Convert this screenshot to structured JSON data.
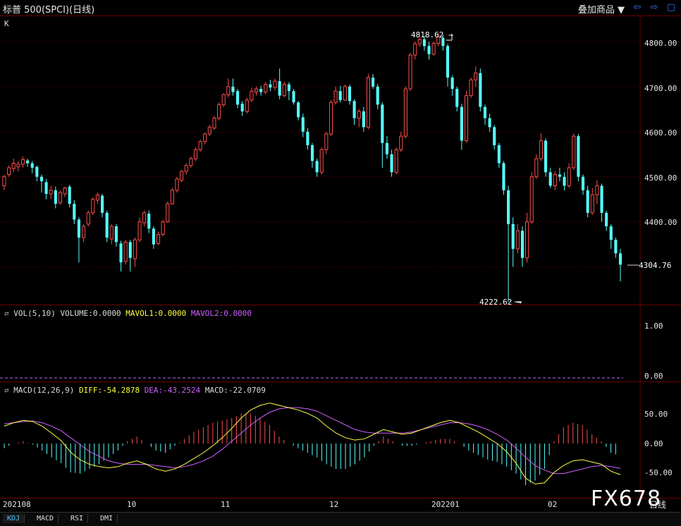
{
  "window": {
    "title": "标普 500(SPCI)(日线)",
    "overlay_label": "叠加商品 ▼",
    "nav_left_icon": "back-arrow-icon",
    "nav_right_icon": "forward-arrow-icon"
  },
  "price_panel": {
    "label": "K",
    "high_marker": "4818.62 →",
    "low_marker": "4222.62 →",
    "last_price": "4304.76"
  },
  "volume_panel": {
    "label": "VOL(5,10)",
    "volume": "VOLUME:0.0000",
    "mavol1": "MAVOL1:0.0000",
    "mavol2": "MAVOL2:0.0000"
  },
  "macd_panel": {
    "label": "MACD(12,26,9)",
    "diff": "DIFF:-54.2878",
    "dea": "DEA:-43.2524",
    "macd": "MACD:-22.0709"
  },
  "axis": {
    "price_ticks": [
      "4800.00",
      "4700.00",
      "4600.00",
      "4500.00",
      "4400.00"
    ],
    "volume_ticks": [
      "1.00",
      "0.00"
    ],
    "macd_ticks": [
      "50.00",
      "0.00",
      "-50.00"
    ],
    "date_labels": [
      "202108",
      "10",
      "11",
      "12",
      "202201",
      "02"
    ],
    "unit": "日线"
  },
  "tabs": [
    "KDJ",
    "MACD",
    "RSI",
    "DMI"
  ],
  "watermark": "FX678",
  "colors": {
    "up": "#ff4d4d",
    "down": "#54ffff",
    "grid": "#6b0000",
    "diff": "#ffff40",
    "dea": "#d060ff"
  },
  "chart_data": {
    "type": "candlestick",
    "title": "标普 500(SPCI)(日线)",
    "ylim": [
      4200,
      4860
    ],
    "high_label": 4818.62,
    "low_label": 4222.62,
    "last": 4304.76,
    "series": [
      {
        "name": "candles",
        "values": [
          [
            4480,
            4500,
            4470,
            4505
          ],
          [
            4505,
            4520,
            4500,
            4525
          ],
          [
            4518,
            4530,
            4510,
            4540
          ],
          [
            4522,
            4528,
            4512,
            4535
          ],
          [
            4528,
            4538,
            4520,
            4545
          ],
          [
            4536,
            4530,
            4522,
            4540
          ],
          [
            4530,
            4520,
            4508,
            4535
          ],
          [
            4522,
            4500,
            4490,
            4525
          ],
          [
            4500,
            4490,
            4465,
            4505
          ],
          [
            4488,
            4462,
            4450,
            4495
          ],
          [
            4462,
            4470,
            4450,
            4480
          ],
          [
            4470,
            4440,
            4430,
            4478
          ],
          [
            4442,
            4465,
            4438,
            4470
          ],
          [
            4462,
            4475,
            4455,
            4478
          ],
          [
            4478,
            4440,
            4432,
            4482
          ],
          [
            4440,
            4405,
            4395,
            4448
          ],
          [
            4405,
            4365,
            4310,
            4410
          ],
          [
            4365,
            4390,
            4355,
            4395
          ],
          [
            4395,
            4420,
            4390,
            4425
          ],
          [
            4420,
            4450,
            4415,
            4455
          ],
          [
            4448,
            4460,
            4440,
            4465
          ],
          [
            4458,
            4420,
            4410,
            4462
          ],
          [
            4420,
            4365,
            4355,
            4425
          ],
          [
            4362,
            4390,
            4350,
            4395
          ],
          [
            4390,
            4355,
            4345,
            4395
          ],
          [
            4352,
            4310,
            4290,
            4358
          ],
          [
            4312,
            4355,
            4305,
            4360
          ],
          [
            4355,
            4320,
            4290,
            4360
          ],
          [
            4318,
            4360,
            4300,
            4365
          ],
          [
            4360,
            4400,
            4355,
            4410
          ],
          [
            4398,
            4420,
            4390,
            4425
          ],
          [
            4418,
            4385,
            4375,
            4425
          ],
          [
            4385,
            4350,
            4340,
            4390
          ],
          [
            4352,
            4372,
            4348,
            4378
          ],
          [
            4372,
            4400,
            4368,
            4405
          ],
          [
            4400,
            4440,
            4398,
            4445
          ],
          [
            4440,
            4470,
            4438,
            4475
          ],
          [
            4470,
            4495,
            4465,
            4500
          ],
          [
            4492,
            4512,
            4488,
            4515
          ],
          [
            4512,
            4525,
            4505,
            4530
          ],
          [
            4525,
            4540,
            4520,
            4545
          ],
          [
            4540,
            4560,
            4535,
            4565
          ],
          [
            4560,
            4578,
            4555,
            4582
          ],
          [
            4578,
            4595,
            4572,
            4598
          ],
          [
            4595,
            4610,
            4590,
            4615
          ],
          [
            4608,
            4630,
            4604,
            4635
          ],
          [
            4630,
            4660,
            4625,
            4665
          ],
          [
            4660,
            4682,
            4655,
            4685
          ],
          [
            4682,
            4700,
            4676,
            4718
          ],
          [
            4700,
            4688,
            4680,
            4718
          ],
          [
            4690,
            4660,
            4652,
            4695
          ],
          [
            4662,
            4645,
            4635,
            4668
          ],
          [
            4645,
            4670,
            4640,
            4675
          ],
          [
            4670,
            4690,
            4665,
            4698
          ],
          [
            4688,
            4695,
            4680,
            4700
          ],
          [
            4695,
            4688,
            4680,
            4702
          ],
          [
            4688,
            4705,
            4683,
            4710
          ],
          [
            4705,
            4698,
            4690,
            4715
          ],
          [
            4698,
            4712,
            4692,
            4718
          ],
          [
            4712,
            4680,
            4672,
            4740
          ],
          [
            4680,
            4705,
            4676,
            4710
          ],
          [
            4705,
            4690,
            4670,
            4710
          ],
          [
            4690,
            4665,
            4660,
            4695
          ],
          [
            4665,
            4632,
            4625,
            4668
          ],
          [
            4632,
            4600,
            4588,
            4640
          ],
          [
            4600,
            4570,
            4560,
            4608
          ],
          [
            4570,
            4535,
            4520,
            4575
          ],
          [
            4535,
            4510,
            4500,
            4540
          ],
          [
            4510,
            4560,
            4505,
            4565
          ],
          [
            4560,
            4595,
            4550,
            4600
          ],
          [
            4595,
            4665,
            4590,
            4670
          ],
          [
            4665,
            4690,
            4660,
            4700
          ],
          [
            4690,
            4670,
            4665,
            4702
          ],
          [
            4670,
            4700,
            4668,
            4705
          ],
          [
            4700,
            4668,
            4660,
            4705
          ],
          [
            4668,
            4630,
            4615,
            4672
          ],
          [
            4630,
            4645,
            4610,
            4650
          ],
          [
            4645,
            4610,
            4600,
            4655
          ],
          [
            4610,
            4720,
            4605,
            4728
          ],
          [
            4720,
            4700,
            4695,
            4728
          ],
          [
            4700,
            4660,
            4650,
            4706
          ],
          [
            4660,
            4575,
            4520,
            4665
          ],
          [
            4575,
            4550,
            4540,
            4590
          ],
          [
            4550,
            4510,
            4500,
            4560
          ],
          [
            4510,
            4560,
            4505,
            4565
          ],
          [
            4560,
            4590,
            4555,
            4600
          ],
          [
            4590,
            4695,
            4585,
            4700
          ],
          [
            4695,
            4770,
            4690,
            4775
          ],
          [
            4770,
            4795,
            4760,
            4800
          ],
          [
            4795,
            4805,
            4788,
            4808
          ],
          [
            4805,
            4790,
            4780,
            4812
          ],
          [
            4790,
            4772,
            4760,
            4800
          ],
          [
            4772,
            4796,
            4768,
            4800
          ],
          [
            4796,
            4810,
            4790,
            4818
          ],
          [
            4808,
            4790,
            4780,
            4815
          ],
          [
            4790,
            4720,
            4700,
            4795
          ],
          [
            4720,
            4695,
            4680,
            4725
          ],
          [
            4695,
            4655,
            4645,
            4700
          ],
          [
            4655,
            4580,
            4560,
            4662
          ],
          [
            4580,
            4680,
            4575,
            4690
          ],
          [
            4680,
            4715,
            4675,
            4720
          ],
          [
            4715,
            4730,
            4700,
            4745
          ],
          [
            4730,
            4655,
            4645,
            4740
          ],
          [
            4655,
            4630,
            4615,
            4660
          ],
          [
            4630,
            4610,
            4600,
            4640
          ],
          [
            4610,
            4570,
            4560,
            4615
          ],
          [
            4570,
            4530,
            4520,
            4575
          ],
          [
            4530,
            4470,
            4460,
            4535
          ],
          [
            4470,
            4395,
            4222,
            4480
          ],
          [
            4395,
            4340,
            4300,
            4410
          ],
          [
            4340,
            4380,
            4330,
            4395
          ],
          [
            4380,
            4320,
            4300,
            4390
          ],
          [
            4320,
            4400,
            4310,
            4420
          ],
          [
            4400,
            4500,
            4395,
            4510
          ],
          [
            4500,
            4540,
            4495,
            4550
          ],
          [
            4540,
            4580,
            4535,
            4596
          ],
          [
            4580,
            4510,
            4500,
            4585
          ],
          [
            4510,
            4480,
            4475,
            4520
          ],
          [
            4480,
            4505,
            4470,
            4512
          ],
          [
            4505,
            4500,
            4490,
            4520
          ],
          [
            4500,
            4480,
            4470,
            4510
          ],
          [
            4480,
            4520,
            4475,
            4530
          ],
          [
            4520,
            4590,
            4515,
            4596
          ],
          [
            4590,
            4500,
            4490,
            4595
          ],
          [
            4500,
            4470,
            4460,
            4505
          ],
          [
            4470,
            4420,
            4410,
            4480
          ],
          [
            4420,
            4460,
            4415,
            4475
          ],
          [
            4460,
            4480,
            4440,
            4492
          ],
          [
            4480,
            4420,
            4400,
            4485
          ],
          [
            4420,
            4390,
            4380,
            4425
          ],
          [
            4390,
            4360,
            4340,
            4395
          ],
          [
            4360,
            4330,
            4320,
            4365
          ],
          [
            4330,
            4305,
            4268,
            4340
          ]
        ]
      },
      {
        "name": "DIFF",
        "values": [
          30,
          36,
          40,
          38,
          30,
          18,
          5,
          -15,
          -28,
          -36,
          -40,
          -42,
          -40,
          -34,
          -30,
          -36,
          -44,
          -48,
          -44,
          -36,
          -26,
          -16,
          -4,
          10,
          26,
          44,
          58,
          66,
          70,
          66,
          62,
          58,
          52,
          44,
          30,
          18,
          10,
          6,
          8,
          16,
          24,
          20,
          16,
          18,
          24,
          30,
          36,
          40,
          36,
          28,
          20,
          10,
          0,
          -14,
          -34,
          -60,
          -70,
          -68,
          -50,
          -38,
          -30,
          -28,
          -32,
          -36,
          -48,
          -54
        ]
      },
      {
        "name": "DEA",
        "values": [
          34,
          36,
          38,
          39,
          36,
          30,
          22,
          10,
          -2,
          -14,
          -22,
          -30,
          -34,
          -36,
          -36,
          -36,
          -38,
          -40,
          -42,
          -40,
          -36,
          -30,
          -22,
          -10,
          4,
          18,
          32,
          44,
          54,
          60,
          62,
          62,
          60,
          56,
          48,
          40,
          32,
          24,
          20,
          18,
          18,
          18,
          18,
          20,
          24,
          28,
          32,
          36,
          36,
          34,
          30,
          24,
          16,
          6,
          -8,
          -24,
          -38,
          -46,
          -52,
          -52,
          -48,
          -44,
          -40,
          -38,
          -40,
          -43
        ]
      }
    ]
  }
}
